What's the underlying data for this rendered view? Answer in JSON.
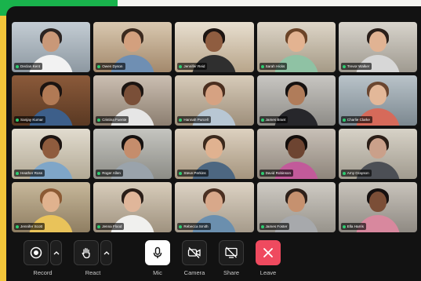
{
  "participants": [
    {
      "name": "Declan Kent",
      "bg1": "#c4cdd4",
      "bg2": "#8d98a1",
      "skin": "#c99878",
      "hair": "#2b2422",
      "shirt": "#f2f2f2"
    },
    {
      "name": "Owen Dyson",
      "bg1": "#d9c8b0",
      "bg2": "#a3896c",
      "skin": "#d3a07e",
      "hair": "#3b2a1f",
      "shirt": "#6f8fb3"
    },
    {
      "name": "Jennifer Reid",
      "bg1": "#e8dfd0",
      "bg2": "#b8a58a",
      "skin": "#8f5d40",
      "hair": "#1d1512",
      "shirt": "#2f2f2f"
    },
    {
      "name": "Sarah Hicks",
      "bg1": "#ded6c8",
      "bg2": "#a59a86",
      "skin": "#e3b391",
      "hair": "#6b4428",
      "shirt": "#8fc2a4"
    },
    {
      "name": "Trevor Walker",
      "bg1": "#d8d4cc",
      "bg2": "#9f9a90",
      "skin": "#e1b393",
      "hair": "#2a1f1a",
      "shirt": "#d7d7d7"
    },
    {
      "name": "Sanjay Kumar",
      "bg1": "#8b5a3a",
      "bg2": "#5a3923",
      "skin": "#b17a55",
      "hair": "#1b1411",
      "shirt": "#3d5f8a"
    },
    {
      "name": "Cristina Fuente",
      "bg1": "#cbbfb2",
      "bg2": "#8c7e70",
      "skin": "#7a4f38",
      "hair": "#1b1411",
      "shirt": "#e6e6e6"
    },
    {
      "name": "Hannah Purcell",
      "bg1": "#d7cbb9",
      "bg2": "#9e8f7b",
      "skin": "#d6a282",
      "hair": "#4a2e1f",
      "shirt": "#b8c7d4"
    },
    {
      "name": "James Brant",
      "bg1": "#c8c6c2",
      "bg2": "#8e8c87",
      "skin": "#b07c5a",
      "hair": "#151110",
      "shirt": "#27272b"
    },
    {
      "name": "Charlie Clarke",
      "bg1": "#b9c3c9",
      "bg2": "#7c8890",
      "skin": "#e3b899",
      "hair": "#6a4630",
      "shirt": "#d66a5a"
    },
    {
      "name": "Heather Ross",
      "bg1": "#e2dccf",
      "bg2": "#b2a995",
      "skin": "#8f5c3e",
      "hair": "#1c1411",
      "shirt": "#7fa6c8"
    },
    {
      "name": "Roger Allen",
      "bg1": "#c5c5c0",
      "bg2": "#8c8c86",
      "skin": "#c58d6c",
      "hair": "#151110",
      "shirt": "#9aa3ab"
    },
    {
      "name": "Steve Perkins",
      "bg1": "#ddd1c0",
      "bg2": "#a5957e",
      "skin": "#e0b290",
      "hair": "#3c2a1d",
      "shirt": "#4d6781"
    },
    {
      "name": "David Robinson",
      "bg1": "#c8c0b7",
      "bg2": "#8e857b",
      "skin": "#6d4431",
      "hair": "#120d0b",
      "shirt": "#c25a9a"
    },
    {
      "name": "Amy Grayson",
      "bg1": "#d7d2c7",
      "bg2": "#a19b8f",
      "skin": "#caa08a",
      "hair": "#2b1e17",
      "shirt": "#4c4f55"
    },
    {
      "name": "Jennifer Scott",
      "bg1": "#c7b89b",
      "bg2": "#8f7e62",
      "skin": "#e0b28e",
      "hair": "#8c5a34",
      "shirt": "#e9c35a"
    },
    {
      "name": "Jenna Flood",
      "bg1": "#d8cdbb",
      "bg2": "#9f927f",
      "skin": "#e0b69a",
      "hair": "#2a1e18",
      "shirt": "#f0f0ee"
    },
    {
      "name": "Rebecca Smith",
      "bg1": "#ddd3c4",
      "bg2": "#a69b8b",
      "skin": "#d8a88a",
      "hair": "#4a3022",
      "shirt": "#6b8fae"
    },
    {
      "name": "James Foster",
      "bg1": "#cfcbc4",
      "bg2": "#97938b",
      "skin": "#c6916f",
      "hair": "#2d201a",
      "shirt": "#a7a9ac"
    },
    {
      "name": "Ella Harris",
      "bg1": "#c9c4bc",
      "bg2": "#8f8a83",
      "skin": "#7b4e37",
      "hair": "#151010",
      "shirt": "#d8889e"
    }
  ],
  "toolbar": {
    "record": {
      "label": "Record",
      "icon": "record-icon"
    },
    "react": {
      "label": "React",
      "icon": "hand-icon"
    },
    "mic": {
      "label": "Mic",
      "icon": "microphone-icon"
    },
    "camera": {
      "label": "Camera",
      "icon": "camera-off-icon"
    },
    "share": {
      "label": "Share",
      "icon": "share-screen-off-icon"
    },
    "leave": {
      "label": "Leave",
      "icon": "close-icon"
    }
  },
  "colors": {
    "accent_green": "#19b34c",
    "accent_yellow": "#f3c63a",
    "leave_red": "#ef4a5f",
    "speaking_dot": "#2ecc71"
  }
}
